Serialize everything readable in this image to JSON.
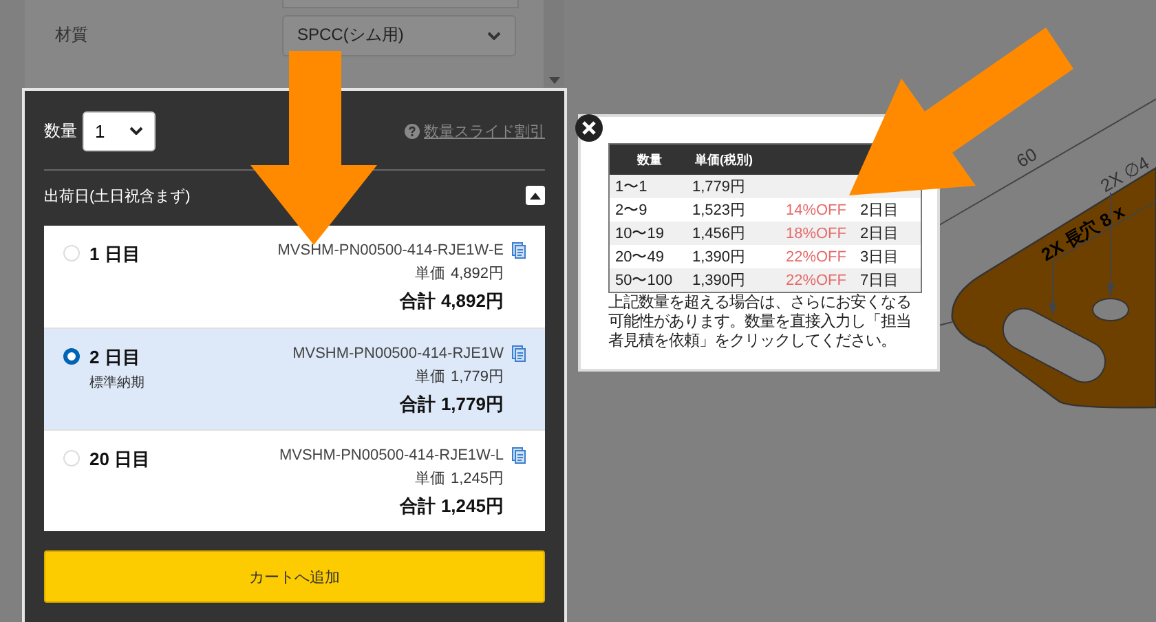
{
  "background_form": {
    "fields": [
      {
        "label": "材質",
        "value": "SPCC(シム用)"
      }
    ]
  },
  "order_panel": {
    "quantity_label": "数量",
    "quantity_value": "1",
    "discount_link": "数量スライド割引",
    "ship_date_heading": "出荷日(土日祝含まず)",
    "expanded": true,
    "options": [
      {
        "days": "1 日目",
        "part_number": "MVSHM-PN00500-414-RJE1W-E",
        "unit_price_label": "単価",
        "unit_price": "4,892円",
        "total_label": "合計",
        "total": "4,892円",
        "selected": false
      },
      {
        "days": "2 日目",
        "note": "標準納期",
        "part_number": "MVSHM-PN00500-414-RJE1W",
        "unit_price_label": "単価",
        "unit_price": "1,779円",
        "total_label": "合計",
        "total": "1,779円",
        "selected": true
      },
      {
        "days": "20 日目",
        "part_number": "MVSHM-PN00500-414-RJE1W-L",
        "unit_price_label": "単価",
        "unit_price": "1,245円",
        "total_label": "合計",
        "total": "1,245円",
        "selected": false
      }
    ],
    "add_to_cart": "カートへ追加"
  },
  "discount_popup": {
    "columns": [
      "数量",
      "単価(税別)"
    ],
    "rows": [
      {
        "quantity": "1〜1",
        "price": "1,779円"
      },
      {
        "quantity": "2〜9",
        "price": "1,523円",
        "discount": "14%OFF",
        "ship_day": "2日目"
      },
      {
        "quantity": "10〜19",
        "price": "1,456円",
        "discount": "18%OFF",
        "ship_day": "2日目"
      },
      {
        "quantity": "20〜49",
        "price": "1,390円",
        "discount": "22%OFF",
        "ship_day": "3日目"
      },
      {
        "quantity": "50〜100",
        "price": "1,390円",
        "discount": "22%OFF",
        "ship_day": "7日目"
      }
    ],
    "note": "上記数量を超える場合は、さらにお安くなる可能性があります。数量を直接入力し「担当者見積を依頼」をクリックしてください。"
  },
  "drawing": {
    "labels": [
      "60",
      "2X ∅4",
      "2X 長穴 8 x"
    ]
  }
}
